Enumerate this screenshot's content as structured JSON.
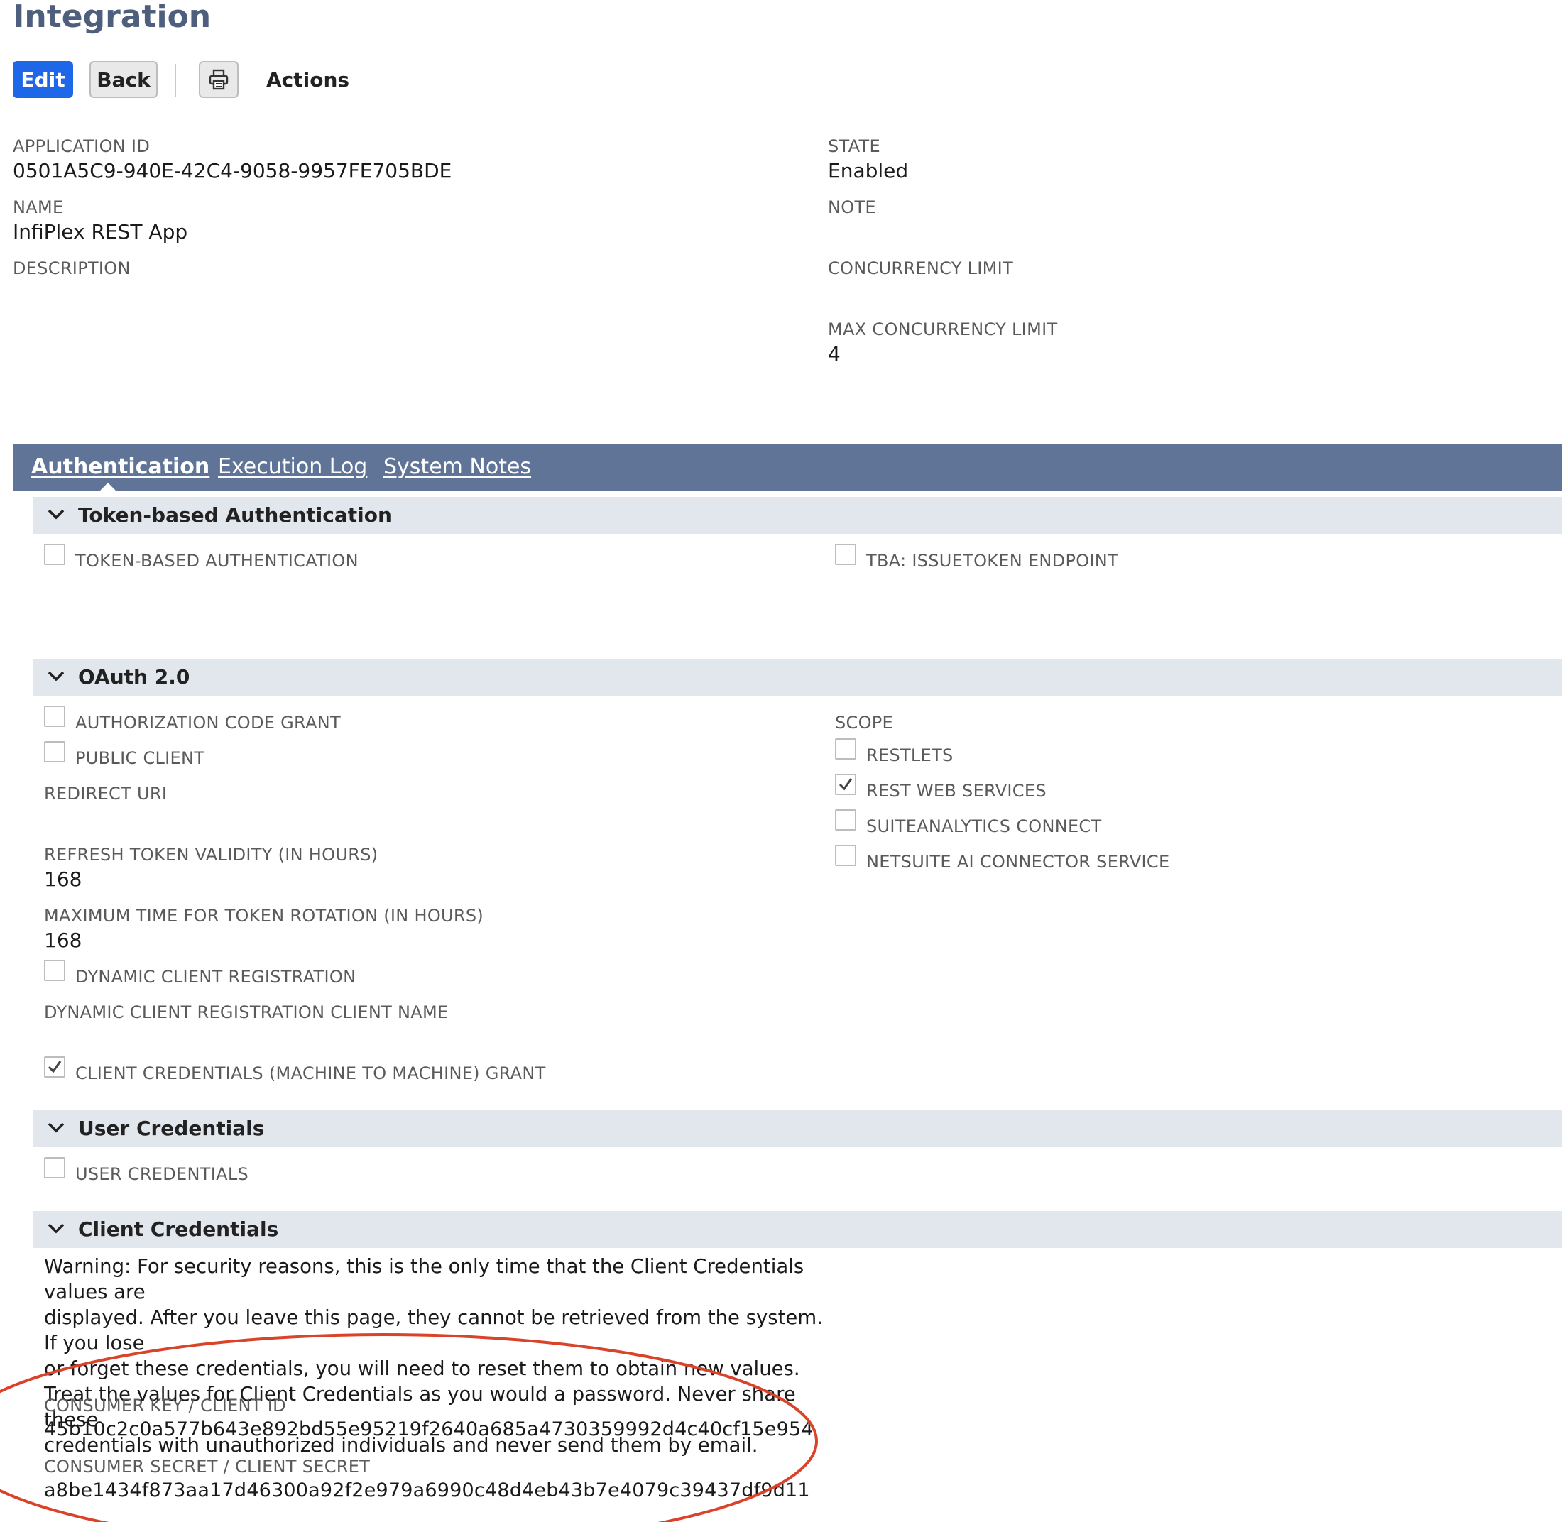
{
  "page": {
    "title": "Integration"
  },
  "toolbar": {
    "edit_label": "Edit",
    "back_label": "Back",
    "print_icon": "printer-icon",
    "actions_label": "Actions"
  },
  "fields_left": {
    "application_id_label": "APPLICATION ID",
    "application_id_value": "0501A5C9-940E-42C4-9058-9957FE705BDE",
    "name_label": "NAME",
    "name_value": "InfiPlex REST App",
    "description_label": "DESCRIPTION"
  },
  "fields_right": {
    "state_label": "STATE",
    "state_value": "Enabled",
    "note_label": "NOTE",
    "concurrency_limit_label": "CONCURRENCY LIMIT",
    "max_concurrency_limit_label": "MAX CONCURRENCY LIMIT",
    "max_concurrency_limit_value": "4"
  },
  "tabs": [
    {
      "label": "Authentication",
      "active": true
    },
    {
      "label": "Execution Log",
      "active": false
    },
    {
      "label": "System Notes",
      "active": false
    }
  ],
  "tba": {
    "title": "Token-based Authentication",
    "token_based_auth_label": "TOKEN-BASED AUTHENTICATION",
    "token_based_auth_checked": false,
    "issuetoken_label": "TBA: ISSUETOKEN ENDPOINT",
    "issuetoken_checked": false
  },
  "oauth": {
    "title": "OAuth 2.0",
    "authorization_code_grant_label": "AUTHORIZATION CODE GRANT",
    "authorization_code_grant_checked": false,
    "public_client_label": "PUBLIC CLIENT",
    "public_client_checked": false,
    "redirect_uri_label": "REDIRECT URI",
    "refresh_token_validity_label": "REFRESH TOKEN VALIDITY (IN HOURS)",
    "refresh_token_validity_value": "168",
    "max_time_token_rotation_label": "MAXIMUM TIME FOR TOKEN ROTATION (IN HOURS)",
    "max_time_token_rotation_value": "168",
    "dynamic_client_registration_label": "DYNAMIC CLIENT REGISTRATION",
    "dynamic_client_registration_checked": false,
    "dynamic_client_registration_client_name_label": "DYNAMIC CLIENT REGISTRATION CLIENT NAME",
    "client_credentials_grant_label": "CLIENT CREDENTIALS (MACHINE TO MACHINE) GRANT",
    "client_credentials_grant_checked": true,
    "scope_label": "SCOPE",
    "scope_restlets_label": "RESTLETS",
    "scope_restlets_checked": false,
    "scope_rest_web_services_label": "REST WEB SERVICES",
    "scope_rest_web_services_checked": true,
    "scope_suiteanalytics_label": "SUITEANALYTICS CONNECT",
    "scope_suiteanalytics_checked": false,
    "scope_ai_connector_label": "NETSUITE AI CONNECTOR SERVICE",
    "scope_ai_connector_checked": false
  },
  "user_credentials": {
    "title": "User Credentials",
    "user_credentials_label": "USER CREDENTIALS",
    "user_credentials_checked": false
  },
  "client_credentials": {
    "title": "Client Credentials",
    "warning_line1": "Warning: For security reasons, this is the only time that the Client Credentials values are",
    "warning_line2": "displayed. After you leave this page, they cannot be retrieved from the system. If you lose",
    "warning_line3": "or forget these credentials, you will need to reset them to obtain new values.",
    "warning_line4": "Treat the values for Client Credentials as you would a password. Never share these",
    "warning_line5": "credentials with unauthorized individuals and never send them by email.",
    "consumer_key_label": "CONSUMER KEY / CLIENT ID",
    "consumer_key_value": "45b10c2c0a577b643e892bd55e95219f2640a685a4730359992d4c40cf15e954",
    "consumer_secret_label": "CONSUMER SECRET / CLIENT SECRET",
    "consumer_secret_value": "a8be1434f873aa17d46300a92f2e979a6990c48d4eb43b7e4079c39437df9d11"
  },
  "colors": {
    "title": "#4d5f7c",
    "edit_button": "#1e67e8",
    "tab_bar": "#5f7497",
    "section_header": "#e2e6ed",
    "annotation_circle": "#d9432a"
  }
}
